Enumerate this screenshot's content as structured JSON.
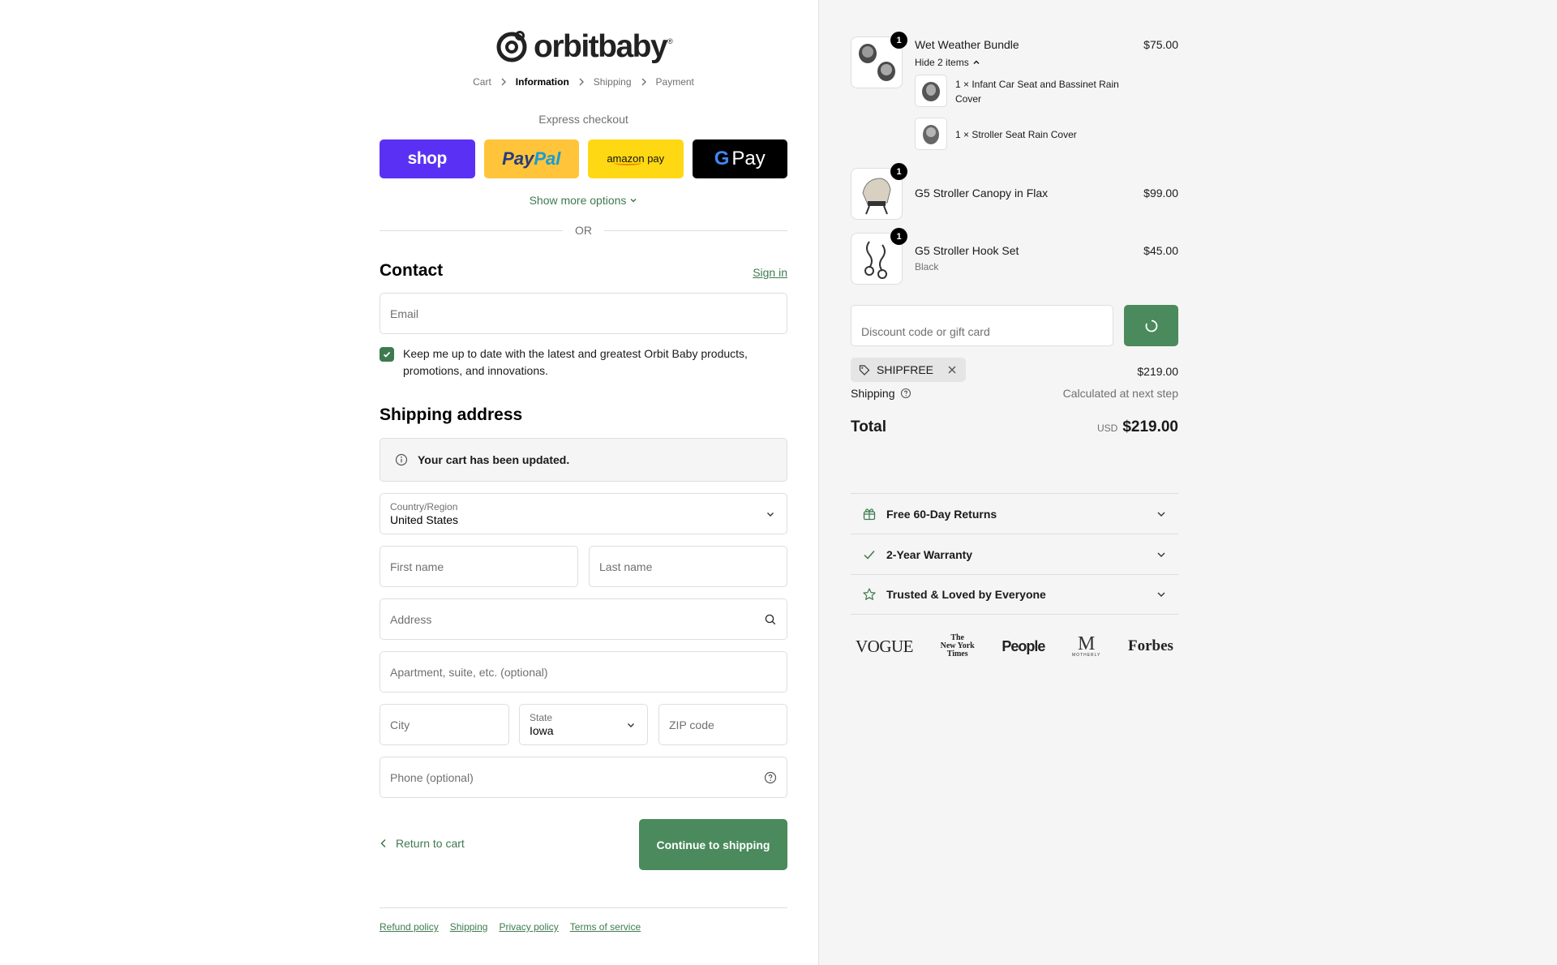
{
  "brand": {
    "name": "orbitbaby",
    "tm": "®"
  },
  "breadcrumb": [
    {
      "label": "Cart"
    },
    {
      "label": "Information"
    },
    {
      "label": "Shipping"
    },
    {
      "label": "Payment"
    }
  ],
  "express": {
    "title": "Express checkout",
    "shop_label": "shop",
    "paypal_part1": "Pay",
    "paypal_part2": "Pal",
    "amazon_label": "amazon pay",
    "gpay_g": "G",
    "gpay_label": "Pay",
    "more_options": "Show more options",
    "or_label": "OR"
  },
  "contact": {
    "title": "Contact",
    "signin": "Sign in",
    "email_placeholder": "Email",
    "newsletter_label": "Keep me up to date with the latest and greatest Orbit Baby products, promotions, and innovations.",
    "newsletter_checked": true
  },
  "shipping_address": {
    "title": "Shipping address",
    "notice": "Your cart has been updated.",
    "country_label": "Country/Region",
    "country_value": "United States",
    "first_name_placeholder": "First name",
    "last_name_placeholder": "Last name",
    "address_placeholder": "Address",
    "apartment_placeholder": "Apartment, suite, etc. (optional)",
    "city_placeholder": "City",
    "state_label": "State",
    "state_value": "Iowa",
    "zip_placeholder": "ZIP code",
    "phone_placeholder": "Phone (optional)"
  },
  "actions": {
    "return_label": "Return to cart",
    "continue_label": "Continue to shipping"
  },
  "footer": {
    "links": [
      "Refund policy",
      "Shipping",
      "Privacy policy",
      "Terms of service"
    ]
  },
  "cart": {
    "items": [
      {
        "name": "Wet Weather Bundle",
        "price": "$75.00",
        "qty": "1",
        "toggle": "Hide 2 items",
        "sub_items": [
          {
            "text": "1 × Infant Car Seat and Bassinet Rain Cover"
          },
          {
            "text": "1 × Stroller Seat Rain Cover"
          }
        ]
      },
      {
        "name": "G5 Stroller Canopy in Flax",
        "price": "$99.00",
        "qty": "1"
      },
      {
        "name": "G5 Stroller Hook Set",
        "variant": "Black",
        "price": "$45.00",
        "qty": "1"
      }
    ],
    "discount_placeholder": "Discount code or gift card",
    "applied_code": "SHIPFREE",
    "subtotal": "$219.00",
    "shipping_label": "Shipping",
    "shipping_value": "Calculated at next step",
    "total_label": "Total",
    "currency": "USD",
    "total": "$219.00"
  },
  "accordion": [
    {
      "label": "Free 60-Day Returns",
      "icon": "gift-box-icon"
    },
    {
      "label": "2-Year Warranty",
      "icon": "check-icon"
    },
    {
      "label": "Trusted & Loved by Everyone",
      "icon": "star-icon"
    }
  ],
  "press": {
    "vogue": "VOGUE",
    "nyt_line1": "The",
    "nyt_line2": "New York",
    "nyt_line3": "Times",
    "people": "People",
    "mothermag_m": "M",
    "mothermag_sub": "MOTHERLY",
    "forbes": "Forbes"
  },
  "colors": {
    "accent": "#3e7a4f",
    "button": "#4a8a5c",
    "shop": "#5a31f4",
    "paypal": "#ffc439",
    "amazon": "#ffd814",
    "gpay": "#000000"
  }
}
